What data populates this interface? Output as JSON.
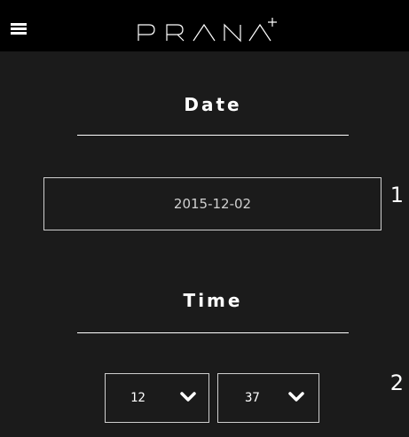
{
  "header": {
    "logo_text": "PRANA+",
    "menu_icon": "hamburger-menu-icon",
    "background": "#000000"
  },
  "date_section": {
    "title": "Date",
    "value": "2015-12-02",
    "step_number": "1"
  },
  "time_section": {
    "title": "Time",
    "hour": "12",
    "minute": "37",
    "dropdown_icon": "chevron-down-icon",
    "step_number": "2"
  },
  "colors": {
    "page_background": "#1b1b1b",
    "text": "#ffffff",
    "field_border": "#cfcfcf"
  }
}
